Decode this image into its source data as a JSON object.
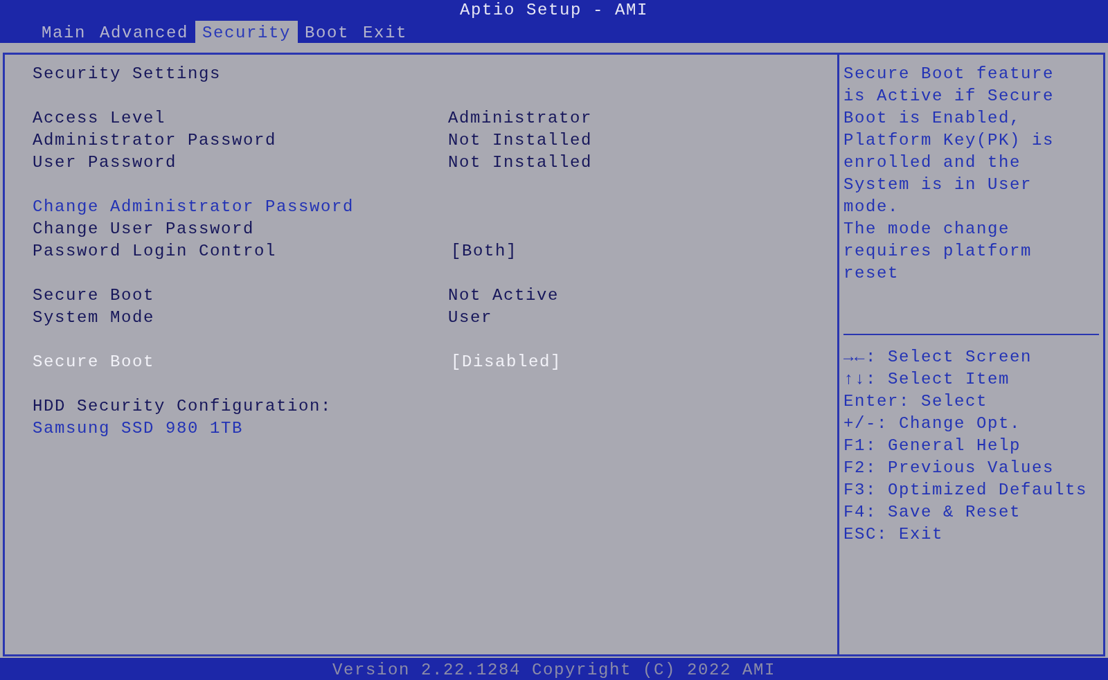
{
  "window": {
    "title": "Aptio Setup - AMI"
  },
  "tabs": [
    {
      "label": "Main",
      "selected": false
    },
    {
      "label": "Advanced",
      "selected": false
    },
    {
      "label": "Security",
      "selected": true
    },
    {
      "label": "Boot",
      "selected": false
    },
    {
      "label": "Exit",
      "selected": false
    }
  ],
  "sections": [
    {
      "rows": [
        {
          "kind": "heading",
          "label": "Security Settings"
        }
      ]
    },
    {
      "rows": [
        {
          "kind": "info",
          "label": "Access Level",
          "value": "Administrator"
        },
        {
          "kind": "info",
          "label": "Administrator Password",
          "value": "Not Installed"
        },
        {
          "kind": "info",
          "label": "User Password",
          "value": "Not Installed"
        }
      ]
    },
    {
      "rows": [
        {
          "kind": "submenu",
          "label": "Change Administrator Password",
          "selected": false
        },
        {
          "kind": "action",
          "label": "Change User Password",
          "selected": false
        },
        {
          "kind": "option",
          "label": "Password Login Control",
          "value": "[Both]",
          "selected": false
        }
      ]
    },
    {
      "rows": [
        {
          "kind": "info",
          "label": "Secure Boot",
          "value": "Not Active"
        },
        {
          "kind": "info",
          "label": "System Mode",
          "value": "User"
        }
      ]
    },
    {
      "rows": [
        {
          "kind": "option",
          "label": "Secure Boot",
          "value": "[Disabled]",
          "selected": true
        }
      ]
    },
    {
      "rows": [
        {
          "kind": "heading",
          "label": "HDD Security Configuration:"
        },
        {
          "kind": "submenu",
          "label": "Samsung SSD 980 1TB",
          "selected": false
        }
      ]
    }
  ],
  "help": [
    "Secure Boot feature",
    "is Active if Secure",
    "Boot is Enabled,",
    "Platform Key(PK) is",
    "enrolled and the",
    "System is in User",
    "mode.",
    "The mode change",
    "requires platform",
    "reset"
  ],
  "keys": [
    "→←: Select Screen",
    "↑↓: Select Item",
    "Enter: Select",
    "+/-: Change Opt.",
    "F1: General Help",
    "F2: Previous Values",
    "F3: Optimized Defaults",
    "F4: Save & Reset",
    "ESC: Exit"
  ],
  "status_bar": "Version 2.22.1284 Copyright (C) 2022 AMI"
}
